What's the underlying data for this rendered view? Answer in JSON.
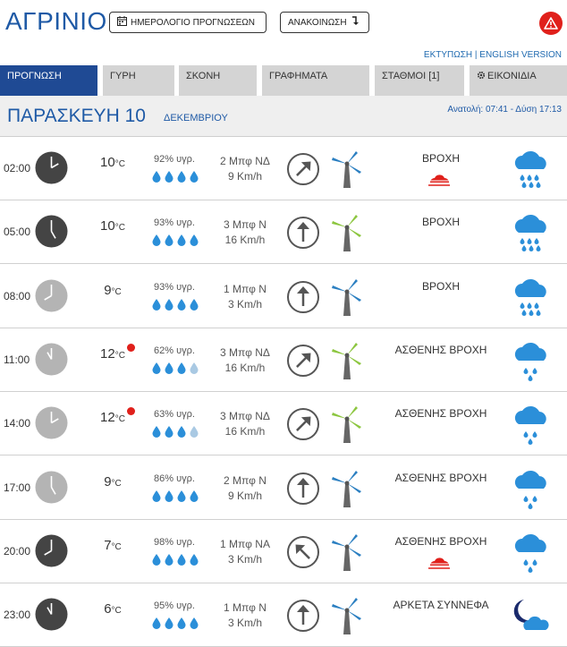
{
  "header": {
    "city": "ΑΓΡΙΝΙΟ",
    "calendar_button": "ΗΜΕΡΟΛΟΓΙΟ ΠΡΟΓΝΩΣΕΩΝ",
    "announcement_button": "ΑΝΑΚΟΙΝΩΣΗ",
    "print_link": "ΕΚΤΥΠΩΣΗ",
    "english_link": "ENGLISH VERSION",
    "link_separator": "|"
  },
  "tabs": [
    "ΠΡΟΓΝΩΣΗ",
    "ΓΥΡΗ",
    "ΣΚΟΝΗ",
    "ΓΡΑΦΗΜΑΤΑ",
    "ΣΤΑΘΜΟΙ [1]",
    "ΕΙΚΟΝΙΔΙΑ"
  ],
  "day": {
    "name": "ΠΑΡΑΣΚΕΥΗ 10",
    "month": "ΔΕΚΕΜΒΡΙΟΥ",
    "sun": "Ανατολή: 07:41 - Δύση 17:13"
  },
  "units": {
    "temp": "°C",
    "humidity_suffix": "% υγρ."
  },
  "colors": {
    "accent": "#1f5aa6",
    "tab_active": "#1f4a94",
    "alert": "#e0201b",
    "drop": "#2b8fd9",
    "turbine_gray": "#555555",
    "turbine_green": "#8cc63f"
  },
  "rows": [
    {
      "time": "02:00",
      "clock": "dark",
      "hour": 2,
      "temp": "10",
      "hot": false,
      "humidity": "92",
      "drops": 4,
      "wind_bf": "2 Μπφ ΝΔ",
      "wind_kmh": "9 Km/h",
      "dir": "ΝΔ",
      "turbine": "gray",
      "condition": "ΒΡΟΧΗ",
      "fog": true,
      "icon": "rain-icon"
    },
    {
      "time": "05:00",
      "clock": "dark",
      "hour": 5,
      "temp": "10",
      "hot": false,
      "humidity": "93",
      "drops": 4,
      "wind_bf": "3 Μπφ Ν",
      "wind_kmh": "16 Km/h",
      "dir": "Ν",
      "turbine": "green",
      "condition": "ΒΡΟΧΗ",
      "fog": false,
      "icon": "rain-icon"
    },
    {
      "time": "08:00",
      "clock": "light",
      "hour": 8,
      "temp": "9",
      "hot": false,
      "humidity": "93",
      "drops": 4,
      "wind_bf": "1 Μπφ Ν",
      "wind_kmh": "3 Km/h",
      "dir": "Ν",
      "turbine": "gray",
      "condition": "ΒΡΟΧΗ",
      "fog": false,
      "icon": "rain-icon"
    },
    {
      "time": "11:00",
      "clock": "light",
      "hour": 11,
      "temp": "12",
      "hot": true,
      "humidity": "62",
      "drops": 3,
      "wind_bf": "3 Μπφ ΝΔ",
      "wind_kmh": "16 Km/h",
      "dir": "ΝΔ",
      "turbine": "green",
      "condition": "ΑΣΘΕΝΗΣ ΒΡΟΧΗ",
      "fog": false,
      "icon": "light-rain-icon"
    },
    {
      "time": "14:00",
      "clock": "light",
      "hour": 2,
      "temp": "12",
      "hot": true,
      "humidity": "63",
      "drops": 3,
      "wind_bf": "3 Μπφ ΝΔ",
      "wind_kmh": "16 Km/h",
      "dir": "ΝΔ",
      "turbine": "green",
      "condition": "ΑΣΘΕΝΗΣ ΒΡΟΧΗ",
      "fog": false,
      "icon": "light-rain-icon"
    },
    {
      "time": "17:00",
      "clock": "light",
      "hour": 5,
      "temp": "9",
      "hot": false,
      "humidity": "86",
      "drops": 4,
      "wind_bf": "2 Μπφ Ν",
      "wind_kmh": "9 Km/h",
      "dir": "Ν",
      "turbine": "gray",
      "condition": "ΑΣΘΕΝΗΣ ΒΡΟΧΗ",
      "fog": false,
      "icon": "light-rain-icon"
    },
    {
      "time": "20:00",
      "clock": "dark",
      "hour": 8,
      "temp": "7",
      "hot": false,
      "humidity": "98",
      "drops": 4,
      "wind_bf": "1 Μπφ ΝΑ",
      "wind_kmh": "3 Km/h",
      "dir": "ΝΑ",
      "turbine": "gray",
      "condition": "ΑΣΘΕΝΗΣ ΒΡΟΧΗ",
      "fog": true,
      "icon": "light-rain-icon"
    },
    {
      "time": "23:00",
      "clock": "dark",
      "hour": 11,
      "temp": "6",
      "hot": false,
      "humidity": "95",
      "drops": 4,
      "wind_bf": "1 Μπφ Ν",
      "wind_kmh": "3 Km/h",
      "dir": "Ν",
      "turbine": "gray",
      "condition": "ΑΡΚΕΤΑ ΣΥΝΝΕΦΑ",
      "fog": false,
      "icon": "night-cloudy-icon"
    }
  ]
}
